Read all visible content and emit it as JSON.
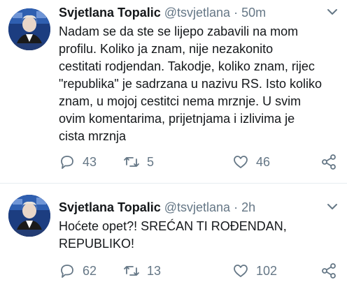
{
  "tweets": [
    {
      "name": "Svjetlana Topalic",
      "handle": "@tsvjetlana",
      "dot": "·",
      "time": "50m",
      "text": "Nadam se da ste se lijepo zabavili na mom\nprofilu. Koliko ja znam, nije nezakonito\ncestitati rodjendan. Takodje, koliko znam, rijec\n\"republika\" je sadrzana u nazivu RS. Isto koliko\nznam, u mojoj cestitci nema mrznje. U svim\novim komentarima, prijetnjama i izlivima je\ncista mrznja",
      "replies": "43",
      "retweets": "5",
      "likes": "46"
    },
    {
      "name": "Svjetlana Topalic",
      "handle": "@tsvjetlana",
      "dot": "·",
      "time": "2h",
      "text": "Hoćete opet?! SREĆAN TI ROĐENDAN,\nREPUBLIKO!",
      "replies": "62",
      "retweets": "13",
      "likes": "102"
    }
  ],
  "icons": {
    "reply": "reply-icon",
    "retweet": "retweet-icon",
    "like": "heart-icon",
    "share": "share-icon",
    "menu": "chevron-down-icon"
  },
  "colors": {
    "text": "#14171a",
    "muted": "#657786",
    "divider": "#e6ecf0"
  }
}
